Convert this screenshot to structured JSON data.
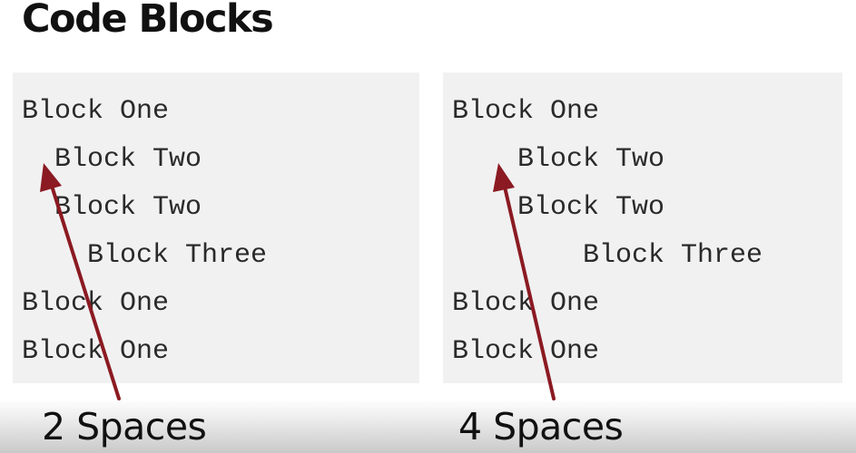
{
  "title": "Code Blocks",
  "panels": [
    {
      "caption": "2 Spaces",
      "lines": [
        "Block One",
        "  Block Two",
        "  Block Two",
        "    Block Three",
        "Block One",
        "Block One"
      ]
    },
    {
      "caption": "4 Spaces",
      "lines": [
        "Block One",
        "    Block Two",
        "    Block Two",
        "        Block Three",
        "Block One",
        "Block One"
      ]
    }
  ],
  "colors": {
    "arrow": "#8b1a22",
    "panel_bg": "#f1f1f1",
    "text": "#111111"
  },
  "icons": [
    "arrow-up-icon"
  ]
}
